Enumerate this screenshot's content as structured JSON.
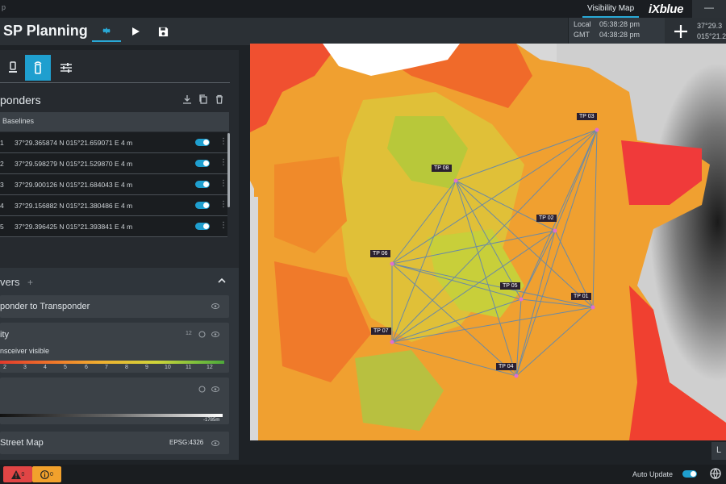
{
  "app": {
    "name": "p",
    "title": "SP Planning"
  },
  "topbar": {
    "tab": "Visibility Map",
    "brand": "iXblue",
    "window_btn": "—"
  },
  "clock": {
    "local_label": "Local",
    "local_time": "05:38:28 pm",
    "gmt_label": "GMT",
    "gmt_time": "04:38:28 pm"
  },
  "coords": {
    "lat": "37°29.3",
    "lon": "015°21.2"
  },
  "transponders": {
    "title": "ponders",
    "baselines_label": "Baselines",
    "items": [
      {
        "num": "1",
        "position": "37°29.365874 N 015°21.659071 E 4 m"
      },
      {
        "num": "2",
        "position": "37°29.598279 N 015°21.529870 E 4 m"
      },
      {
        "num": "3",
        "position": "37°29.900126 N 015°21.684043 E 4 m"
      },
      {
        "num": "4",
        "position": "37°29.156882 N 015°21.380486 E 4 m"
      },
      {
        "num": "5",
        "position": "37°29.396425 N 015°21.393841 E 4 m"
      }
    ]
  },
  "layers": {
    "title": "vers",
    "plus": "+",
    "items": [
      {
        "name": "ponder to Transponder"
      },
      {
        "name": "ity",
        "count": "12",
        "subtitle": "nsceiver visible",
        "legend": [
          "2",
          "3",
          "4",
          "5",
          "6",
          "7",
          "8",
          "9",
          "10",
          "11",
          "12"
        ]
      },
      {
        "name": "",
        "depth_label": "-1785m"
      },
      {
        "name": "Street Map",
        "crs": "EPSG:4326"
      }
    ]
  },
  "map": {
    "markers": [
      {
        "label": "TP 03"
      },
      {
        "label": "TP 08"
      },
      {
        "label": "TP 02"
      },
      {
        "label": "TP 06"
      },
      {
        "label": "TP 05"
      },
      {
        "label": "TP 01"
      },
      {
        "label": "TP 07"
      },
      {
        "label": "TP 04"
      }
    ],
    "corner_label": "L"
  },
  "statusbar": {
    "warn_count": "0",
    "info_count": "0",
    "auto_update": "Auto Update"
  },
  "colors": {
    "accent": "#1f9fcf",
    "panel": "#262a2f",
    "header": "#2b3035",
    "marker": "#e070d0"
  }
}
